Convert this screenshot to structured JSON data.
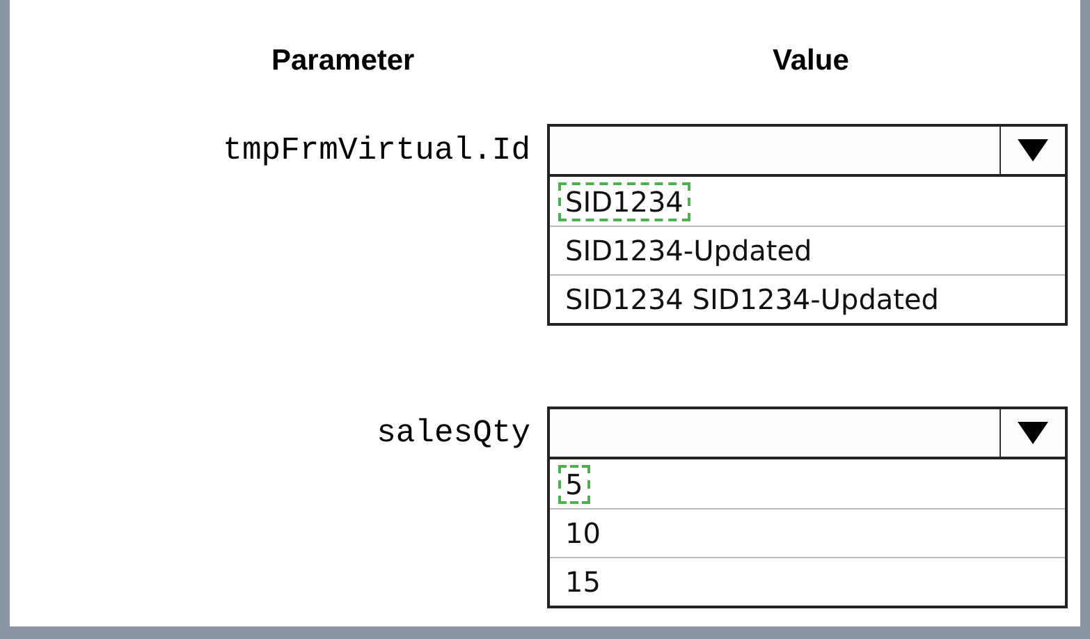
{
  "headers": [
    "Parameter",
    "Value"
  ],
  "parameters": [
    {
      "name": "tmpFrmVirtual.Id",
      "options": [
        {
          "label": "SID1234",
          "selected": true
        },
        {
          "label": "SID1234-Updated",
          "selected": false
        },
        {
          "label": "SID1234 SID1234-Updated",
          "selected": false
        }
      ]
    },
    {
      "name": "salesQty",
      "options": [
        {
          "label": "5",
          "selected": true
        },
        {
          "label": "10",
          "selected": false
        },
        {
          "label": "15",
          "selected": false
        }
      ]
    }
  ]
}
